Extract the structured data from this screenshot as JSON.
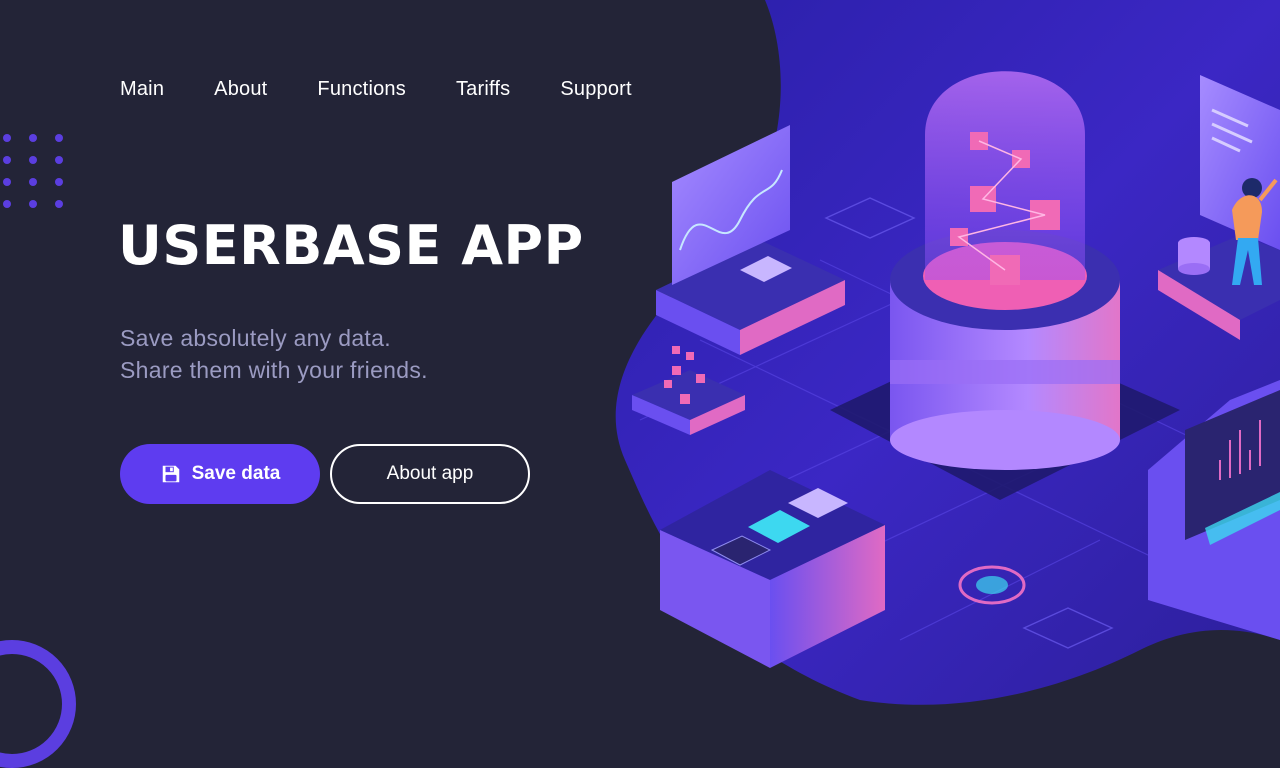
{
  "nav": {
    "items": [
      {
        "label": "Main"
      },
      {
        "label": "About"
      },
      {
        "label": "Functions"
      },
      {
        "label": "Tariffs"
      },
      {
        "label": "Support"
      }
    ]
  },
  "hero": {
    "title": "USERBASE APP",
    "subtitle_line1": "Save absolutely any data.",
    "subtitle_line2": "Share them with your friends.",
    "primary_button": {
      "label": "Save data",
      "icon": "floppy-disk-icon"
    },
    "secondary_button": {
      "label": "About app"
    }
  },
  "colors": {
    "background": "#232437",
    "accent": "#5e3cf0",
    "subtitle": "#9b9bc2",
    "illustration_base": "#2f24a8",
    "illustration_highlight": "#e55bb3"
  }
}
